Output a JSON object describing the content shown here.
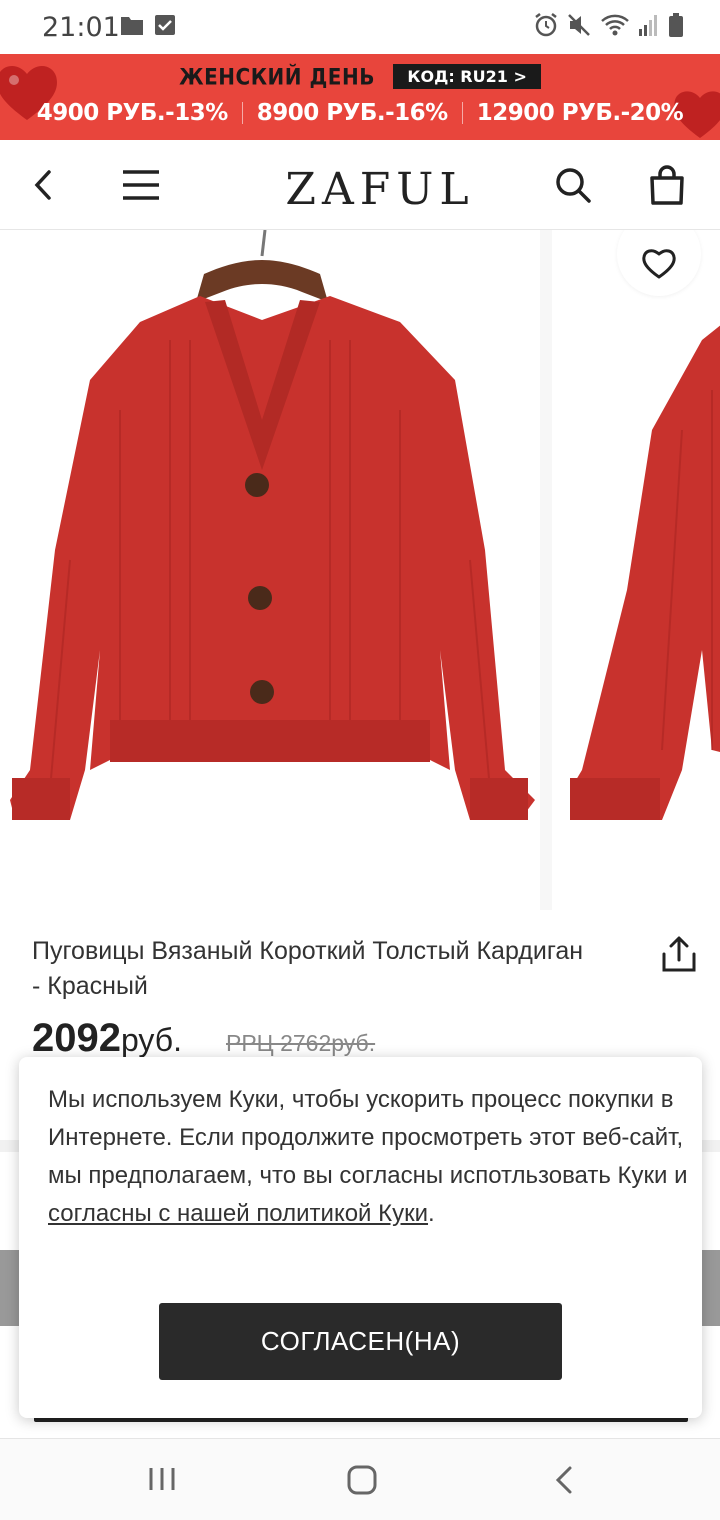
{
  "status_bar": {
    "time": "21:01"
  },
  "promo": {
    "title": "ЖЕНСКИЙ ДЕНЬ",
    "code": "КОД: RU21 >",
    "tiers": [
      "4900 РУБ.-13%",
      "8900 РУБ.-16%",
      "12900 РУБ.-20%"
    ],
    "background_color": "#e8453c"
  },
  "header": {
    "logo": "ZAFUL",
    "icons": [
      "back-icon",
      "menu-icon",
      "search-icon",
      "bag-icon"
    ]
  },
  "product": {
    "name": "Пуговицы Вязаный Короткий Толстый Кардиган - Красный",
    "price_value": "2092",
    "price_currency": "руб.",
    "rrc": "РРЦ 2762руб.",
    "image_color": "#c8322d"
  },
  "cookie_popup": {
    "text": "Мы используем Куки, чтобы ускорить процесс покупки в Интернете. Если продолжите просмотреть этот веб-сайт, мы предполагаем, что вы согласны испотльзовать Куки и ",
    "link": "согласны с нашей политикой Куки",
    "text_end": ".",
    "button": "СОГЛАСЕН(НА)"
  },
  "nav_bar": {
    "icons": [
      "recents-icon",
      "home-icon",
      "back-nav-icon"
    ]
  }
}
